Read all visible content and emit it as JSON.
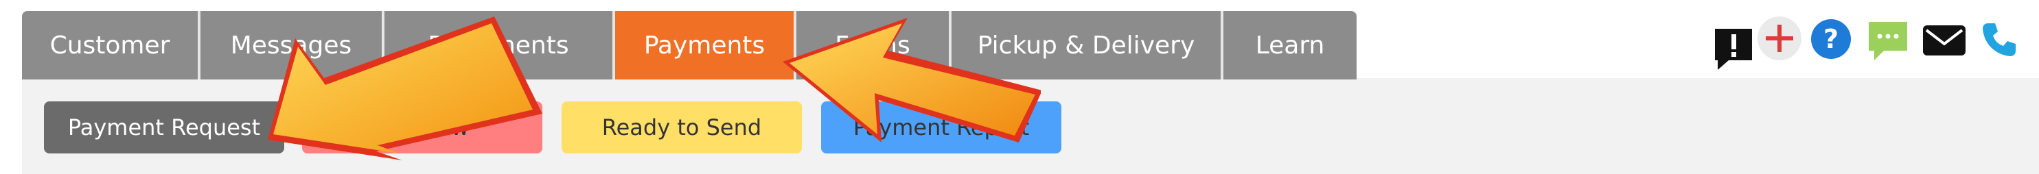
{
  "tabs": [
    {
      "label": "Customer",
      "active": false
    },
    {
      "label": "Messages",
      "active": false
    },
    {
      "label": "Documents",
      "active": false
    },
    {
      "label": "Payments",
      "active": true
    },
    {
      "label": "Forms",
      "active": false
    },
    {
      "label": "Pickup & Delivery",
      "active": false
    },
    {
      "label": "Learn",
      "active": false
    }
  ],
  "buttons": {
    "payment_request": {
      "label": "Payment Request",
      "color": "#6b6b6b"
    },
    "pay_now": {
      "label": "Pay Now",
      "color": "#ff7f80"
    },
    "ready_to_send": {
      "label": "Ready to Send",
      "color": "#ffdf66"
    },
    "payment_report": {
      "label": "Payment Report",
      "color": "#4ea1fa"
    }
  },
  "header_icons": [
    "alert-icon",
    "add-icon",
    "help-icon",
    "chat-icon",
    "mail-icon",
    "phone-icon"
  ],
  "colors": {
    "accent": "#f07026",
    "tab_bg": "#8c8c8c",
    "help_blue": "#1f7bd8",
    "chat_green": "#9bd05a",
    "phone_blue": "#21a4e0",
    "add_red": "#e03b3b"
  }
}
